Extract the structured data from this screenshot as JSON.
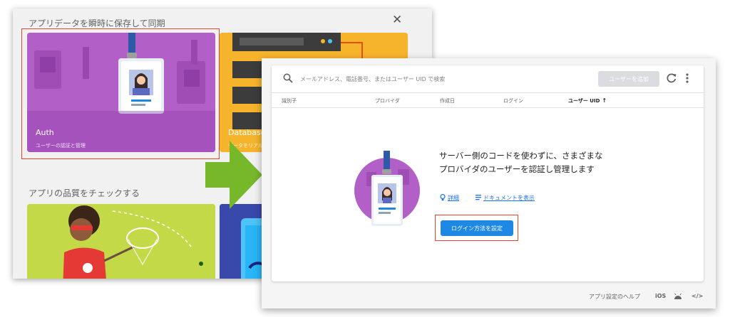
{
  "back_window": {
    "title": "アプリデータを瞬時に保存して同期",
    "close_glyph": "✕",
    "auth_card": {
      "title": "Auth",
      "subtitle": "ユーザーの認証と管理"
    },
    "database_card": {
      "title": "Database",
      "subtitle": "データをリアル"
    },
    "quality_section_title": "アプリの品質をチェックする"
  },
  "front_window": {
    "search": {
      "placeholder": "メールアドレス、電話番号、またはユーザー UID で検索"
    },
    "add_user_label": "ユーザーを追加",
    "columns": [
      "識別子",
      "プロバイダ",
      "作成日",
      "ログイン",
      "ユーザー UID"
    ],
    "sort_glyph": "↑",
    "empty_state": {
      "message": "サーバー側のコードを使わずに、さまざまなプロバイダのユーザーを認証し管理します",
      "link_details": "詳細",
      "link_docs": "ドキュメントを表示",
      "setup_button_label": "ログイン方法を設定"
    },
    "footer": {
      "help_label": "アプリ設定のヘルプ",
      "ios_label": "iOS",
      "code_glyph": "</>"
    }
  },
  "colors": {
    "auth_purple": "#b25fc7",
    "database_yellow": "#f6b42c",
    "arrow_green": "#76b82a",
    "primary_blue": "#1e88e5",
    "highlight_red": "#e8462f"
  }
}
